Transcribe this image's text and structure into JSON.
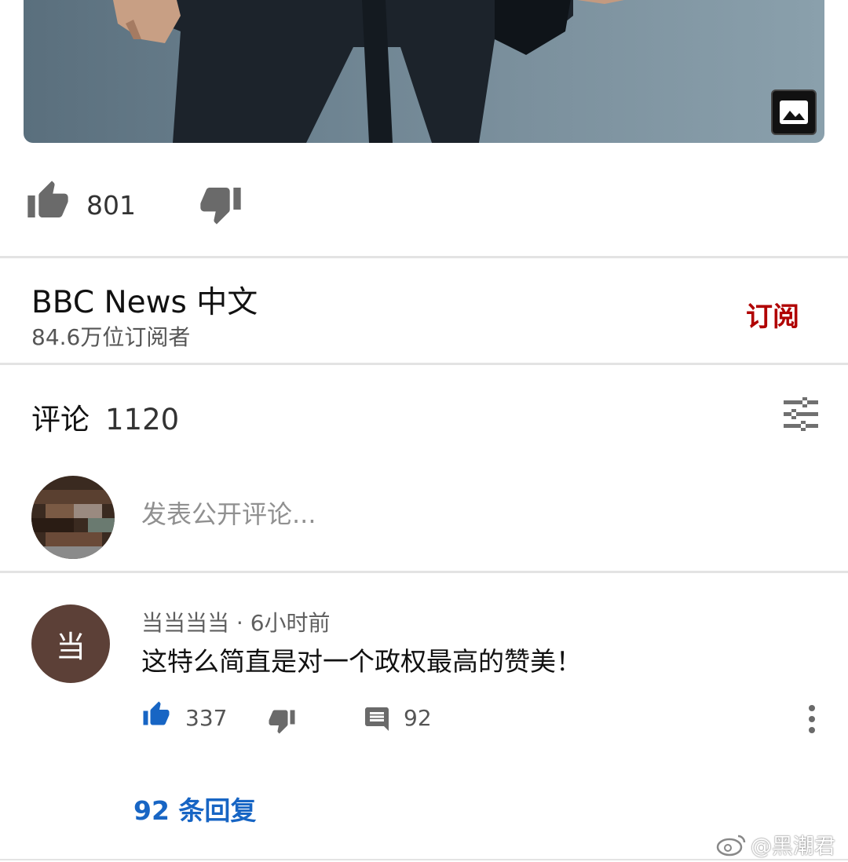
{
  "video": {
    "like_count": "801"
  },
  "channel": {
    "name": "BBC News 中文",
    "subscribers": "84.6万位订阅者",
    "subscribe_label": "订阅",
    "subscribe_color": "#b00000"
  },
  "comments_section": {
    "title": "评论",
    "count": "1120",
    "input_placeholder": "发表公开评论..."
  },
  "comments": [
    {
      "avatar_char": "当",
      "avatar_color": "#5c4037",
      "meta": "当当当当 · 6小时前",
      "text": "这特么简直是对一个政权最高的赞美！",
      "like_count": "337",
      "reply_count": "92",
      "replies_label": "92 条回复",
      "replies_color": "#1765c4"
    }
  ],
  "watermark": {
    "text": "@黑潮君"
  },
  "icons": [
    "thumb-up-icon",
    "thumb-down-icon",
    "image-icon",
    "sort-icon",
    "comment-icon",
    "more-vert-icon",
    "weibo-icon"
  ]
}
